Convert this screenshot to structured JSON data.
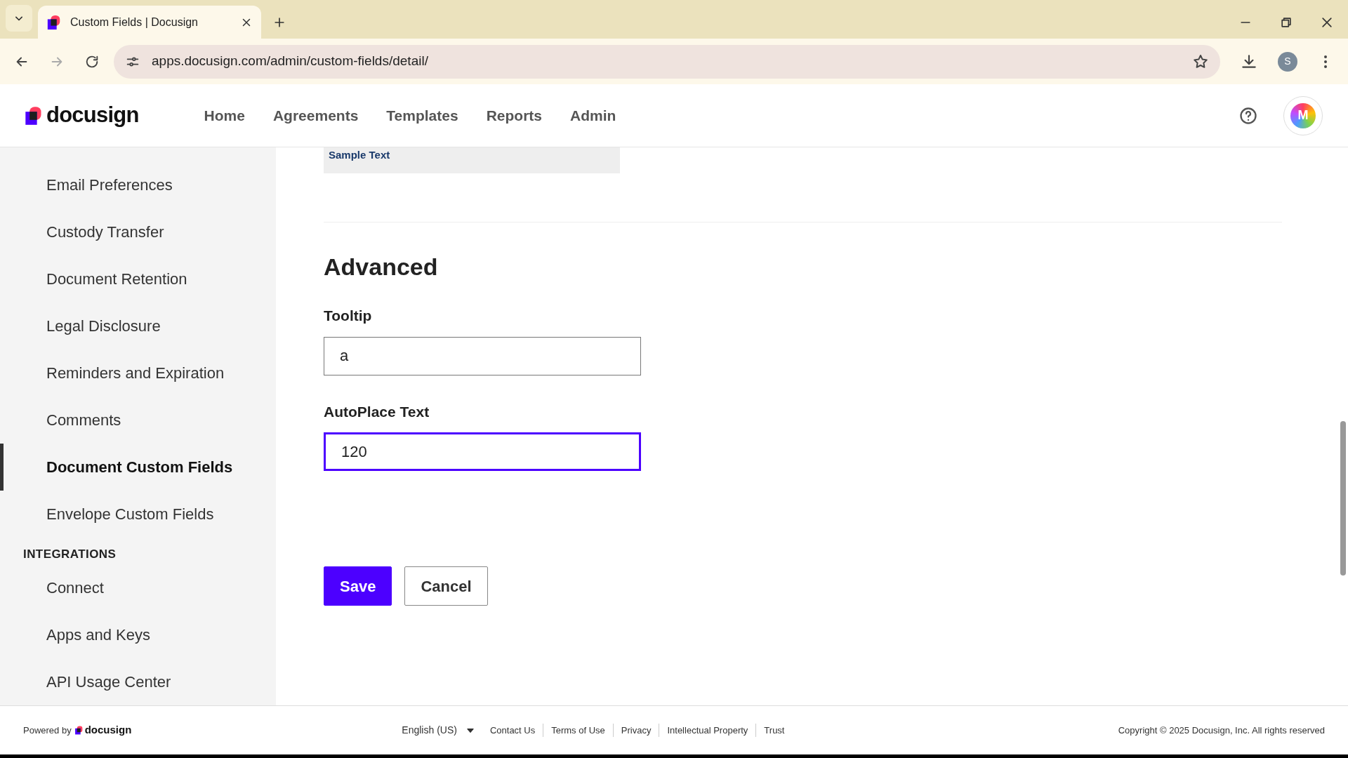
{
  "browser": {
    "tab_title": "Custom Fields | Docusign",
    "url": "apps.docusign.com/admin/custom-fields/detail/",
    "profile_initial": "S"
  },
  "header": {
    "logo": "docusign",
    "nav": [
      {
        "label": "Home",
        "selected": false
      },
      {
        "label": "Agreements",
        "selected": false
      },
      {
        "label": "Templates",
        "selected": false
      },
      {
        "label": "Reports",
        "selected": false
      },
      {
        "label": "Admin",
        "selected": false
      }
    ],
    "avatar_initial": "M"
  },
  "sidebar": {
    "items": [
      {
        "kind": "link",
        "label": "Email Preferences",
        "selected": false
      },
      {
        "kind": "link",
        "label": "Custody Transfer",
        "selected": false
      },
      {
        "kind": "link",
        "label": "Document Retention",
        "selected": false
      },
      {
        "kind": "link",
        "label": "Legal Disclosure",
        "selected": false
      },
      {
        "kind": "link",
        "label": "Reminders and Expiration",
        "selected": false
      },
      {
        "kind": "link",
        "label": "Comments",
        "selected": false
      },
      {
        "kind": "link",
        "label": "Document Custom Fields",
        "selected": true
      },
      {
        "kind": "link",
        "label": "Envelope Custom Fields",
        "selected": false
      },
      {
        "kind": "heading",
        "label": "INTEGRATIONS"
      },
      {
        "kind": "link",
        "label": "Connect",
        "selected": false
      },
      {
        "kind": "link",
        "label": "Apps and Keys",
        "selected": false
      },
      {
        "kind": "link",
        "label": "API Usage Center",
        "selected": false
      }
    ]
  },
  "preview": {
    "text": "Sample Text"
  },
  "section_title": "Advanced",
  "fields": [
    {
      "label": "Tooltip",
      "value": "a",
      "focused": false
    },
    {
      "label": "AutoPlace Text",
      "value": "120",
      "focused": true
    }
  ],
  "buttons": [
    {
      "label": "Save",
      "kind": "primary"
    },
    {
      "label": "Cancel",
      "kind": "secondary"
    }
  ],
  "footer": {
    "powered_by": "Powered by",
    "logo": "docusign",
    "language": "English (US)",
    "links": [
      "Contact Us",
      "Terms of Use",
      "Privacy",
      "Intellectual Property",
      "Trust"
    ],
    "copyright": "Copyright © 2025 Docusign, Inc. All rights reserved"
  }
}
